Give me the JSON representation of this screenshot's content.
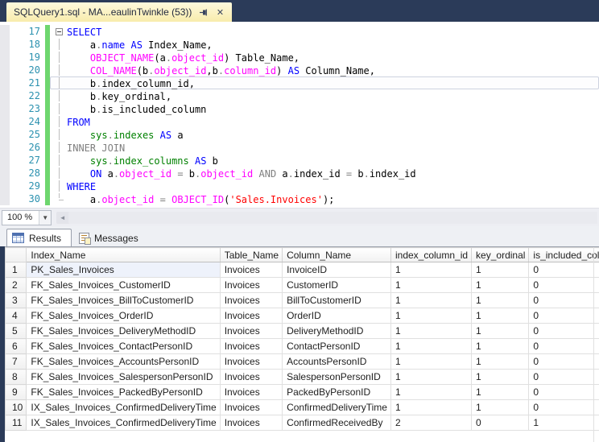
{
  "window": {
    "tab_title": "SQLQuery1.sql - MA...eaulinTwinkle (53))",
    "pin_icon": "pin-icon",
    "close_icon": "close-icon",
    "close_glyph": "✕"
  },
  "colors": {
    "title_bar_navy": "#2b3b59",
    "active_tab_yellow": "#f8ecac",
    "keyword_blue": "#0000ff",
    "system_function_magenta": "#ff00ff",
    "string_red": "#ff0000",
    "operator_gray": "#808080",
    "system_table_green": "#008000",
    "line_number_teal": "#2b91af",
    "change_bar_green": "#6ed66e"
  },
  "editor": {
    "zoom_label": "100 %",
    "current_line": 21,
    "scrollbar_left_arrow": "◄",
    "zoom_drop_arrow": "▼",
    "lines": [
      {
        "n": 17,
        "fold": "start",
        "tokens": [
          [
            "SELECT",
            "kw"
          ]
        ]
      },
      {
        "n": 18,
        "fold": "mid",
        "tokens": [
          [
            "    a",
            "pl"
          ],
          [
            ".",
            "op"
          ],
          [
            "name",
            "kw"
          ],
          [
            " ",
            "pl"
          ],
          [
            "AS",
            "kw"
          ],
          [
            " Index_Name,",
            "pl"
          ]
        ]
      },
      {
        "n": 19,
        "fold": "mid",
        "tokens": [
          [
            "    ",
            "pl"
          ],
          [
            "OBJECT_NAME",
            "fn"
          ],
          [
            "(a",
            "pl"
          ],
          [
            ".",
            "op"
          ],
          [
            "object_id",
            "fn"
          ],
          [
            ") Table_Name,",
            "pl"
          ]
        ]
      },
      {
        "n": 20,
        "fold": "mid",
        "tokens": [
          [
            "    ",
            "pl"
          ],
          [
            "COL_NAME",
            "fn"
          ],
          [
            "(b",
            "pl"
          ],
          [
            ".",
            "op"
          ],
          [
            "object_id",
            "fn"
          ],
          [
            ",b",
            "pl"
          ],
          [
            ".",
            "op"
          ],
          [
            "column_id",
            "fn"
          ],
          [
            ") ",
            "pl"
          ],
          [
            "AS",
            "kw"
          ],
          [
            " Column_Name,",
            "pl"
          ]
        ]
      },
      {
        "n": 21,
        "fold": "mid",
        "tokens": [
          [
            "    b",
            "pl"
          ],
          [
            ".",
            "op"
          ],
          [
            "index_column_id,",
            "pl"
          ]
        ]
      },
      {
        "n": 22,
        "fold": "mid",
        "tokens": [
          [
            "    b",
            "pl"
          ],
          [
            ".",
            "op"
          ],
          [
            "key_ordinal,",
            "pl"
          ]
        ]
      },
      {
        "n": 23,
        "fold": "mid",
        "tokens": [
          [
            "    b",
            "pl"
          ],
          [
            ".",
            "op"
          ],
          [
            "is_included_column",
            "pl"
          ]
        ]
      },
      {
        "n": 24,
        "fold": "mid",
        "tokens": [
          [
            "FROM",
            "kw"
          ]
        ]
      },
      {
        "n": 25,
        "fold": "mid",
        "tokens": [
          [
            "    ",
            "pl"
          ],
          [
            "sys",
            "sys"
          ],
          [
            ".",
            "op"
          ],
          [
            "indexes",
            "sys"
          ],
          [
            " ",
            "pl"
          ],
          [
            "AS",
            "kw"
          ],
          [
            " a",
            "pl"
          ]
        ]
      },
      {
        "n": 26,
        "fold": "mid",
        "tokens": [
          [
            "INNER JOIN",
            "op"
          ]
        ]
      },
      {
        "n": 27,
        "fold": "mid",
        "tokens": [
          [
            "    ",
            "pl"
          ],
          [
            "sys",
            "sys"
          ],
          [
            ".",
            "op"
          ],
          [
            "index_columns",
            "sys"
          ],
          [
            " ",
            "pl"
          ],
          [
            "AS",
            "kw"
          ],
          [
            " b",
            "pl"
          ]
        ]
      },
      {
        "n": 28,
        "fold": "mid",
        "tokens": [
          [
            "    ",
            "pl"
          ],
          [
            "ON",
            "kw"
          ],
          [
            " a",
            "pl"
          ],
          [
            ".",
            "op"
          ],
          [
            "object_id",
            "fn"
          ],
          [
            " ",
            "pl"
          ],
          [
            "=",
            "op"
          ],
          [
            " b",
            "pl"
          ],
          [
            ".",
            "op"
          ],
          [
            "object_id",
            "fn"
          ],
          [
            " ",
            "pl"
          ],
          [
            "AND",
            "op"
          ],
          [
            " a",
            "pl"
          ],
          [
            ".",
            "op"
          ],
          [
            "index_id",
            "pl"
          ],
          [
            " ",
            "pl"
          ],
          [
            "=",
            "op"
          ],
          [
            " b",
            "pl"
          ],
          [
            ".",
            "op"
          ],
          [
            "index_id",
            "pl"
          ]
        ]
      },
      {
        "n": 29,
        "fold": "mid",
        "tokens": [
          [
            "WHERE",
            "kw"
          ]
        ]
      },
      {
        "n": 30,
        "fold": "end",
        "tokens": [
          [
            "    a",
            "pl"
          ],
          [
            ".",
            "op"
          ],
          [
            "object_id",
            "fn"
          ],
          [
            " ",
            "pl"
          ],
          [
            "=",
            "op"
          ],
          [
            " ",
            "pl"
          ],
          [
            "OBJECT_ID",
            "fn"
          ],
          [
            "(",
            "pl"
          ],
          [
            "'Sales.Invoices'",
            "str"
          ],
          [
            ");",
            "pl"
          ]
        ]
      }
    ]
  },
  "results": {
    "tabs": [
      {
        "label": "Results",
        "icon": "results-grid-icon"
      },
      {
        "label": "Messages",
        "icon": "messages-icon"
      }
    ],
    "grid": {
      "columns": [
        "Index_Name",
        "Table_Name",
        "Column_Name",
        "index_column_id",
        "key_ordinal",
        "is_included_column"
      ],
      "rows": [
        [
          "PK_Sales_Invoices",
          "Invoices",
          "InvoiceID",
          "1",
          "1",
          "0"
        ],
        [
          "FK_Sales_Invoices_CustomerID",
          "Invoices",
          "CustomerID",
          "1",
          "1",
          "0"
        ],
        [
          "FK_Sales_Invoices_BillToCustomerID",
          "Invoices",
          "BillToCustomerID",
          "1",
          "1",
          "0"
        ],
        [
          "FK_Sales_Invoices_OrderID",
          "Invoices",
          "OrderID",
          "1",
          "1",
          "0"
        ],
        [
          "FK_Sales_Invoices_DeliveryMethodID",
          "Invoices",
          "DeliveryMethodID",
          "1",
          "1",
          "0"
        ],
        [
          "FK_Sales_Invoices_ContactPersonID",
          "Invoices",
          "ContactPersonID",
          "1",
          "1",
          "0"
        ],
        [
          "FK_Sales_Invoices_AccountsPersonID",
          "Invoices",
          "AccountsPersonID",
          "1",
          "1",
          "0"
        ],
        [
          "FK_Sales_Invoices_SalespersonPersonID",
          "Invoices",
          "SalespersonPersonID",
          "1",
          "1",
          "0"
        ],
        [
          "FK_Sales_Invoices_PackedByPersonID",
          "Invoices",
          "PackedByPersonID",
          "1",
          "1",
          "0"
        ],
        [
          "IX_Sales_Invoices_ConfirmedDeliveryTime",
          "Invoices",
          "ConfirmedDeliveryTime",
          "1",
          "1",
          "0"
        ],
        [
          "IX_Sales_Invoices_ConfirmedDeliveryTime",
          "Invoices",
          "ConfirmedReceivedBy",
          "2",
          "0",
          "1"
        ]
      ],
      "focused_cell": {
        "row": 1,
        "column": "Index_Name"
      }
    }
  }
}
